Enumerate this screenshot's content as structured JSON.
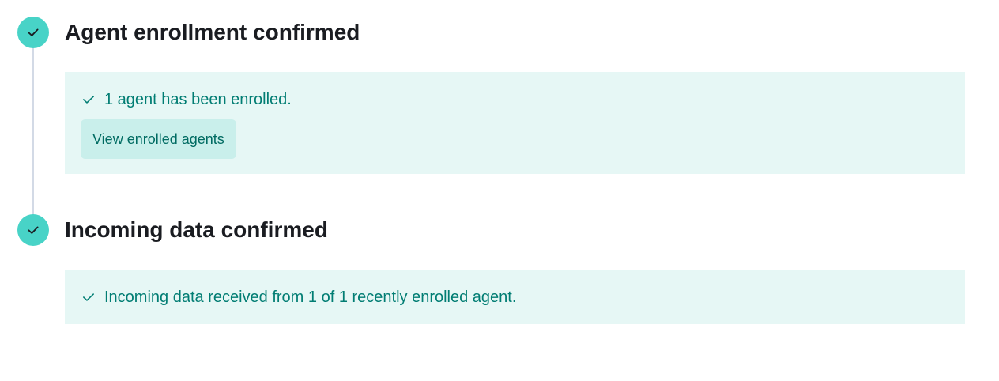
{
  "steps": [
    {
      "icon": "check-icon",
      "status": "complete",
      "title": "Agent enrollment confirmed",
      "callout": {
        "message": "1 agent has been enrolled.",
        "button_label": "View enrolled agents"
      }
    },
    {
      "icon": "check-icon",
      "status": "complete",
      "title": "Incoming data confirmed",
      "callout": {
        "message": "Incoming data received from 1 of 1 recently enrolled agent."
      }
    }
  ],
  "colors": {
    "step_complete": "#48d3c7",
    "callout_background": "#e6f7f5",
    "callout_text": "#017d73",
    "button_background": "#c9efeb",
    "title_text": "#1a1c21"
  }
}
